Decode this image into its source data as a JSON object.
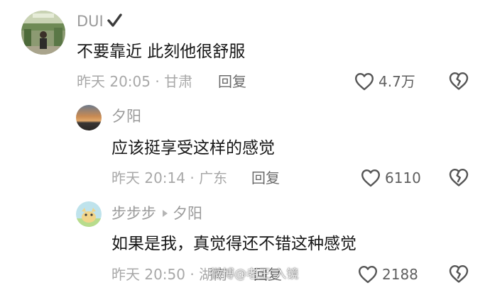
{
  "comments": [
    {
      "author": "DUI",
      "text": "不要靠近 此刻他很舒服",
      "meta": "昨天 20:05 · 甘肃",
      "reply_label": "回复",
      "likes": "4.7万"
    },
    {
      "author": "夕阳",
      "text": "应该挺享受这样的感觉",
      "meta": "昨天 20:14 · 广东",
      "reply_label": "回复",
      "likes": "6110"
    },
    {
      "author": "步步步",
      "reply_to": "夕阳",
      "text": "如果是我，真觉得还不错这种感觉",
      "meta": "昨天 20:50 · 湖南",
      "reply_label": "回复",
      "likes": "2188"
    }
  ],
  "watermark": "微博@老王 入镜",
  "icons": {
    "verified": "checkmark-icon",
    "like": "heart-icon",
    "dislike": "broken-heart-icon",
    "reply_arrow": "triangle-right-icon"
  },
  "colors": {
    "author": "#9a9a9a",
    "text": "#161616",
    "meta": "#a8a8a8",
    "icon": "#555555"
  }
}
